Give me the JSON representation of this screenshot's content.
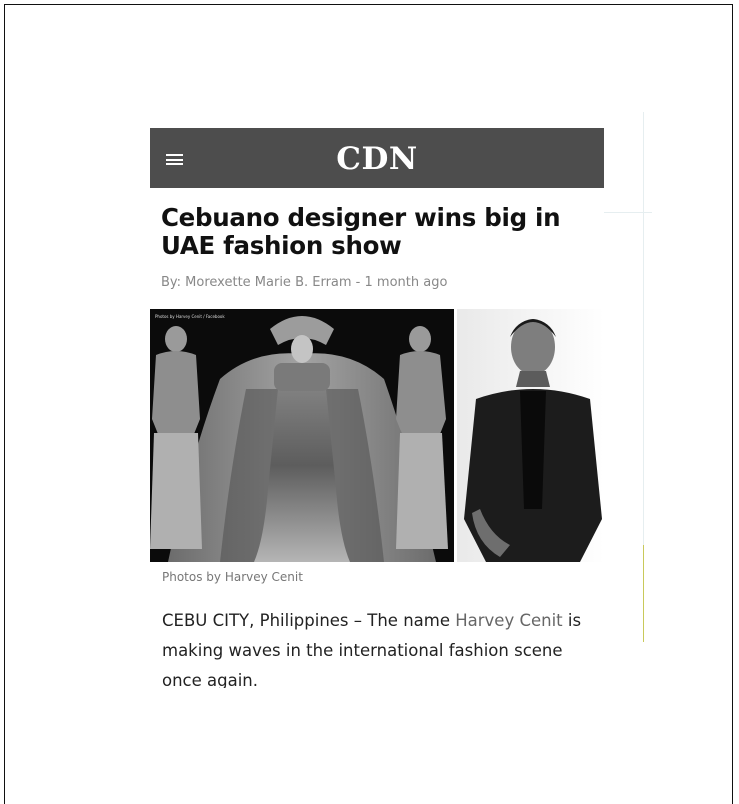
{
  "site": {
    "logo": "CDN",
    "menu_icon": "hamburger-menu-icon"
  },
  "article": {
    "headline": "Cebuano designer wins big in UAE fashion show",
    "byline": "By: Morexette Marie B. Erram - 1 month ago",
    "photo_credit_overlay": "Photos by Harvey Cenit / Facebook",
    "caption": "Photos by Harvey Cenit",
    "body_pre": "CEBU CITY, Philippines – The name ",
    "body_link": "Harvey Cenit",
    "body_post": " is making waves in the international fashion scene once again."
  }
}
